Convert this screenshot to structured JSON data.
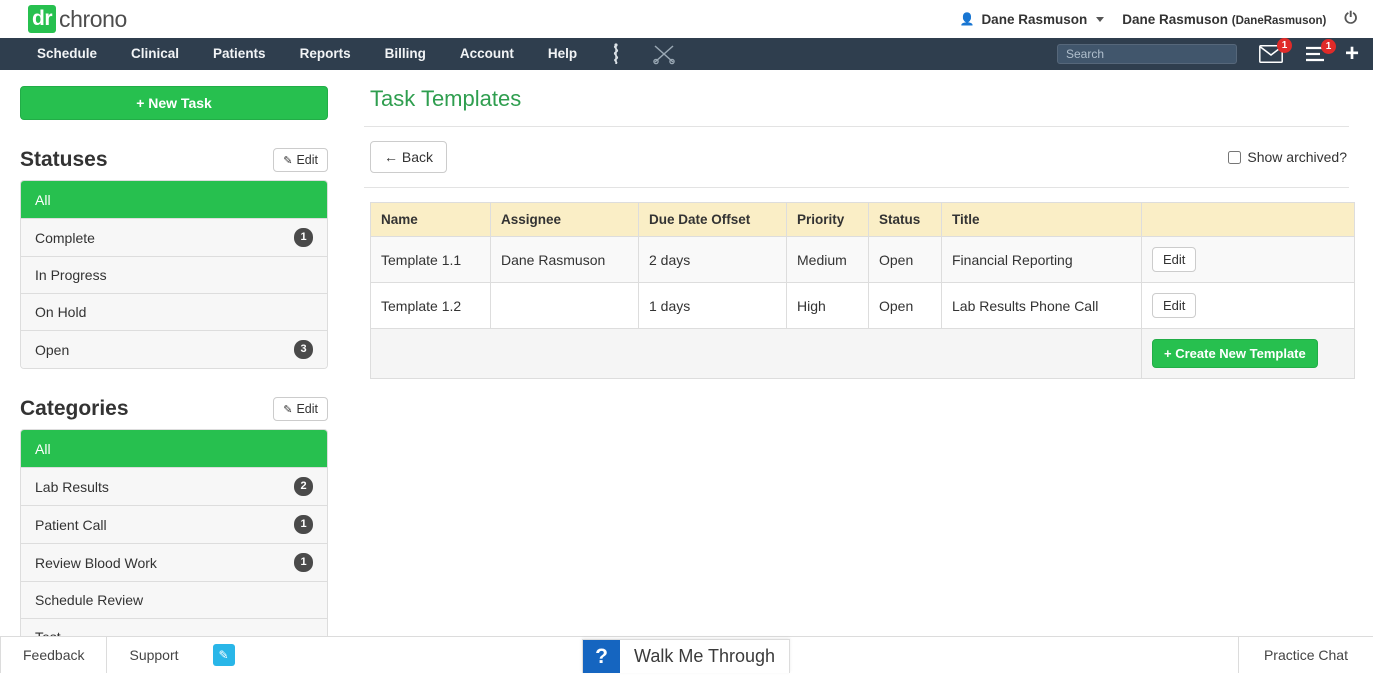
{
  "brand": {
    "logo_prefix": "dr",
    "logo_suffix": "chrono",
    "green": "#27c04f",
    "navy": "#2f3e4e",
    "red": "#e02b29"
  },
  "topbar": {
    "user_menu_label": "Dane Rasmuson",
    "account_name": "Dane Rasmuson",
    "account_handle": "(DaneRasmuson)",
    "user_icon": "user-icon",
    "caret_icon": "chevron-down-icon",
    "power_icon": "power-off-icon"
  },
  "navbar": {
    "items": [
      {
        "label": "Schedule"
      },
      {
        "label": "Clinical"
      },
      {
        "label": "Patients"
      },
      {
        "label": "Reports"
      },
      {
        "label": "Billing"
      },
      {
        "label": "Account"
      },
      {
        "label": "Help"
      }
    ],
    "icons": [
      {
        "name": "caduceus-icon"
      },
      {
        "name": "crossed-instruments-icon"
      }
    ],
    "search": {
      "placeholder": "Search",
      "value": ""
    },
    "messages_badge": "1",
    "tasks_badge": "1",
    "plus_label": "+"
  },
  "sidebar": {
    "new_task_label": "+ New Task",
    "statuses": {
      "title": "Statuses",
      "edit_label": "Edit",
      "items": [
        {
          "label": "All",
          "count": "",
          "active": true
        },
        {
          "label": "Complete",
          "count": "1",
          "active": false
        },
        {
          "label": "In Progress",
          "count": "",
          "active": false
        },
        {
          "label": "On Hold",
          "count": "",
          "active": false
        },
        {
          "label": "Open",
          "count": "3",
          "active": false
        }
      ]
    },
    "categories": {
      "title": "Categories",
      "edit_label": "Edit",
      "items": [
        {
          "label": "All",
          "count": "",
          "active": true
        },
        {
          "label": "Lab Results",
          "count": "2",
          "active": false
        },
        {
          "label": "Patient Call",
          "count": "1",
          "active": false
        },
        {
          "label": "Review Blood Work",
          "count": "1",
          "active": false
        },
        {
          "label": "Schedule Review",
          "count": "",
          "active": false
        },
        {
          "label": "Test",
          "count": "",
          "active": false
        }
      ]
    }
  },
  "main": {
    "page_title": "Task Templates",
    "back_label": "← Back",
    "show_archived_label": "Show archived?",
    "show_archived_checked": false,
    "table": {
      "columns": [
        "Name",
        "Assignee",
        "Due Date Offset",
        "Priority",
        "Status",
        "Title",
        ""
      ],
      "rows": [
        {
          "name": "Template 1.1",
          "assignee": "Dane Rasmuson",
          "due_date_offset": "2 days",
          "priority": "Medium",
          "status": "Open",
          "title": "Financial Reporting",
          "action_label": "Edit"
        },
        {
          "name": "Template 1.2",
          "assignee": "",
          "due_date_offset": "1 days",
          "priority": "High",
          "status": "Open",
          "title": "Lab Results Phone Call",
          "action_label": "Edit"
        }
      ],
      "create_label": "+ Create New Template"
    }
  },
  "footer": {
    "feedback_label": "Feedback",
    "support_label": "Support",
    "pencil_icon": "pencil-icon",
    "walkme_icon": "question-mark-icon",
    "walkme_label": "Walk Me Through",
    "practice_chat_label": "Practice Chat"
  }
}
